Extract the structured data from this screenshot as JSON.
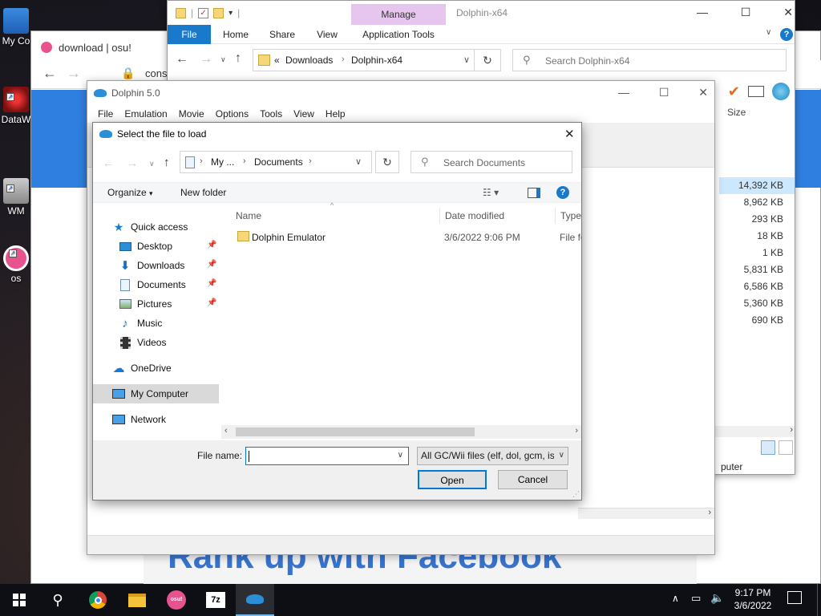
{
  "desktop": {
    "icons": [
      {
        "label": "My Co"
      },
      {
        "label": "DataW"
      },
      {
        "label": "WM"
      },
      {
        "label": "os"
      }
    ]
  },
  "browser": {
    "tab_title": "download | osu!",
    "address_fragment": "cons",
    "banner_text": "Rank up with Facebook"
  },
  "explorer": {
    "title": "Dolphin-x64",
    "manage_label": "Manage",
    "tabs": [
      "File",
      "Home",
      "Share",
      "View",
      "Application Tools"
    ],
    "breadcrumb": [
      "Downloads",
      "Dolphin-x64"
    ],
    "search_placeholder": "Search Dolphin-x64",
    "size_header": "Size",
    "sizes": [
      "14,392 KB",
      "8,962 KB",
      "293 KB",
      "18 KB",
      "1 KB",
      "5,831 KB",
      "6,586 KB",
      "5,360 KB",
      "690 KB"
    ],
    "status_fragment": "puter"
  },
  "dolphin": {
    "title": "Dolphin 5.0",
    "menu": [
      "File",
      "Emulation",
      "Movie",
      "Options",
      "Tools",
      "View",
      "Help"
    ]
  },
  "dialog": {
    "title": "Select the file to load",
    "breadcrumb": [
      "My ...",
      "Documents"
    ],
    "search_placeholder": "Search Documents",
    "organize_label": "Organize",
    "new_folder_label": "New folder",
    "nav": {
      "quick_access": "Quick access",
      "pinned": [
        "Desktop",
        "Downloads",
        "Documents",
        "Pictures"
      ],
      "unpinned": [
        "Music",
        "Videos"
      ],
      "onedrive": "OneDrive",
      "my_computer": "My Computer",
      "network": "Network"
    },
    "columns": {
      "name": "Name",
      "date": "Date modified",
      "type": "Type"
    },
    "files": [
      {
        "name": "Dolphin Emulator",
        "date": "3/6/2022 9:06 PM",
        "type": "File fo"
      }
    ],
    "filename_label": "File name:",
    "filename_value": "",
    "filter_value": "All GC/Wii files (elf, dol, gcm, is",
    "open_label": "Open",
    "cancel_label": "Cancel"
  },
  "taskbar": {
    "time": "9:17 PM",
    "date": "3/6/2022"
  },
  "colors": {
    "accent": "#0078d7",
    "manage_bg": "#e6c5ef",
    "osu_pink": "#e8528e",
    "browser_blue": "#2f7fe0"
  }
}
